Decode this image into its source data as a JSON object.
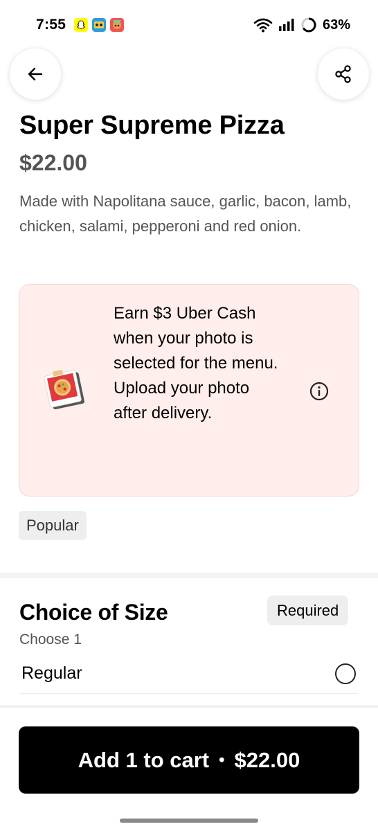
{
  "status_bar": {
    "time": "7:55",
    "battery": "63%",
    "app_icons": [
      "snapchat-icon",
      "pixel-app-icon",
      "game-app-icon"
    ]
  },
  "header": {
    "back_icon": "arrow-left-icon",
    "share_icon": "share-icon"
  },
  "item": {
    "title": "Super Supreme Pizza",
    "price": "$22.00",
    "description": "Made with Napolitana sauce, garlic, bacon, lamb, chicken, salami, pepperoni and red onion."
  },
  "promo": {
    "text": "Earn $3 Uber Cash when your photo is selected for the menu. Upload your photo after delivery.",
    "icon": "info-icon",
    "background": "#ffeeeb"
  },
  "badges": {
    "popular": "Popular"
  },
  "size_section": {
    "title": "Choice of Size",
    "required": "Required",
    "subtitle": "Choose 1",
    "options": [
      {
        "label": "Regular",
        "selected": false
      }
    ]
  },
  "cart": {
    "label": "Add 1 to cart",
    "separator": "•",
    "price": "$22.00"
  }
}
